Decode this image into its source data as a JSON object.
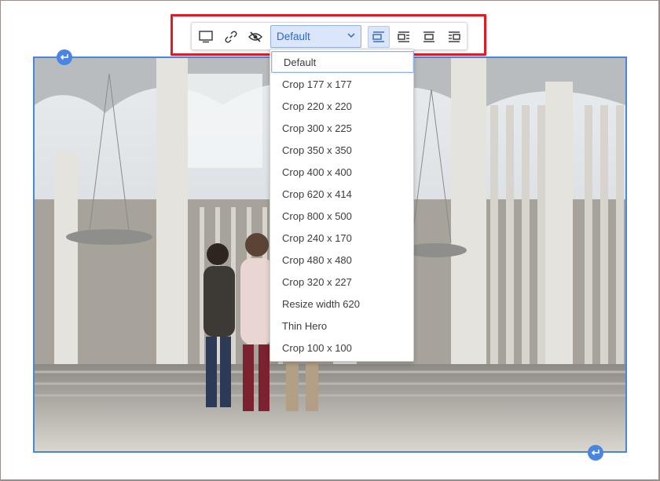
{
  "toolbar": {
    "buttons": [
      {
        "name": "desktop-icon"
      },
      {
        "name": "link-icon"
      },
      {
        "name": "eye-slash-icon"
      }
    ],
    "style_select": {
      "value": "Default",
      "icon": "chevron-down-icon"
    },
    "align_buttons": [
      {
        "name": "align-none-icon",
        "active": true
      },
      {
        "name": "align-left-wrap-icon",
        "active": false
      },
      {
        "name": "align-center-icon",
        "active": false
      },
      {
        "name": "align-right-wrap-icon",
        "active": false
      }
    ]
  },
  "dropdown": {
    "items": [
      "Default",
      "Crop 177 x 177",
      "Crop 220 x 220",
      "Crop 300 x 225",
      "Crop 350 x 350",
      "Crop 400 x 400",
      "Crop 620 x 414",
      "Crop 800 x 500",
      "Crop 240 x 170",
      "Crop 480 x 480",
      "Crop 320 x 227",
      "Resize width 620",
      "Thin Hero",
      "Crop 100 x 100"
    ],
    "selected": "Default"
  },
  "image": {
    "description_icon": "photo-of-building-with-people"
  },
  "colors": {
    "highlight": "#e01b24",
    "accent": "#4a86e0",
    "select_bg": "#dbe6fb",
    "select_text": "#2f67c7"
  }
}
